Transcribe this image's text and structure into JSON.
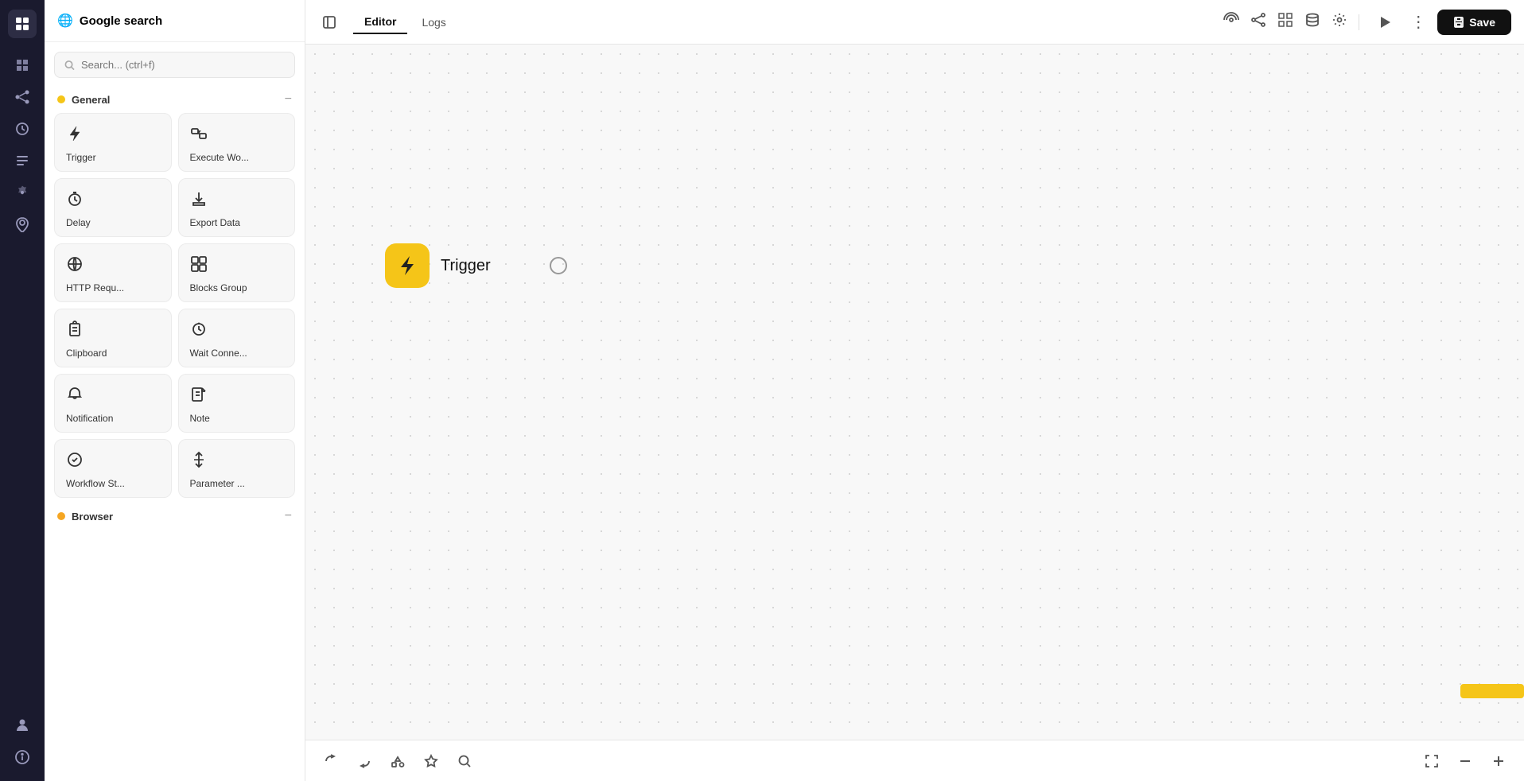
{
  "app": {
    "title": "Google search",
    "logo_char": "▣"
  },
  "nav": {
    "icons": [
      {
        "name": "blocks-icon",
        "symbol": "⊞",
        "label": "Blocks"
      },
      {
        "name": "workflows-icon",
        "symbol": "⊡",
        "label": "Workflows"
      },
      {
        "name": "history-icon",
        "symbol": "◷",
        "label": "History"
      },
      {
        "name": "logs-icon",
        "symbol": "☰",
        "label": "Logs"
      },
      {
        "name": "settings-icon",
        "symbol": "⚙",
        "label": "Settings"
      },
      {
        "name": "location-icon",
        "symbol": "◎",
        "label": "Location"
      }
    ],
    "bottom_icons": [
      {
        "name": "user-icon",
        "symbol": "👤",
        "label": "User"
      },
      {
        "name": "info-icon",
        "symbol": "ℹ",
        "label": "Info"
      }
    ]
  },
  "sidebar": {
    "search_placeholder": "Search... (ctrl+f)",
    "sections": [
      {
        "title": "General",
        "dot_color": "#f5c518",
        "collapsed": false,
        "items": [
          {
            "label": "Trigger",
            "icon": "⚡"
          },
          {
            "label": "Execute Wo...",
            "icon": "⇄"
          },
          {
            "label": "Delay",
            "icon": "⏱"
          },
          {
            "label": "Export Data",
            "icon": "⬇"
          },
          {
            "label": "HTTP Requ...",
            "icon": "↻"
          },
          {
            "label": "Blocks Group",
            "icon": "⊡"
          },
          {
            "label": "Clipboard",
            "icon": "📋"
          },
          {
            "label": "Wait Conne...",
            "icon": "⏱"
          },
          {
            "label": "Notification",
            "icon": "🔔"
          },
          {
            "label": "Note",
            "icon": "📝"
          },
          {
            "label": "Workflow St...",
            "icon": "⚙"
          },
          {
            "label": "Parameter ...",
            "icon": "✱"
          }
        ]
      },
      {
        "title": "Browser",
        "dot_color": "#f5a623",
        "collapsed": false,
        "items": []
      }
    ]
  },
  "topbar": {
    "tabs": [
      {
        "label": "Editor",
        "active": true
      },
      {
        "label": "Logs",
        "active": false
      }
    ],
    "icons": [
      {
        "name": "antenna-icon",
        "symbol": "📡"
      },
      {
        "name": "share-icon",
        "symbol": "⎇"
      },
      {
        "name": "grid-icon",
        "symbol": "⊞"
      },
      {
        "name": "database-icon",
        "symbol": "⊕"
      },
      {
        "name": "gear-icon",
        "symbol": "⚙"
      }
    ],
    "run_label": "▶",
    "more_label": "⋮",
    "save_label": "Save"
  },
  "canvas": {
    "trigger_node": {
      "label": "Trigger",
      "icon": "⚡"
    }
  },
  "bottom_toolbar": {
    "icons": [
      {
        "name": "undo-icon",
        "symbol": "↩"
      },
      {
        "name": "redo-icon",
        "symbol": "↪"
      },
      {
        "name": "add-block-icon",
        "symbol": "⊕"
      },
      {
        "name": "star-icon",
        "symbol": "✦"
      },
      {
        "name": "search-icon",
        "symbol": "🔍"
      }
    ],
    "right_icons": [
      {
        "name": "fullscreen-icon",
        "symbol": "⛶"
      },
      {
        "name": "zoom-out-icon",
        "symbol": "−"
      },
      {
        "name": "zoom-in-icon",
        "symbol": "+"
      }
    ]
  }
}
